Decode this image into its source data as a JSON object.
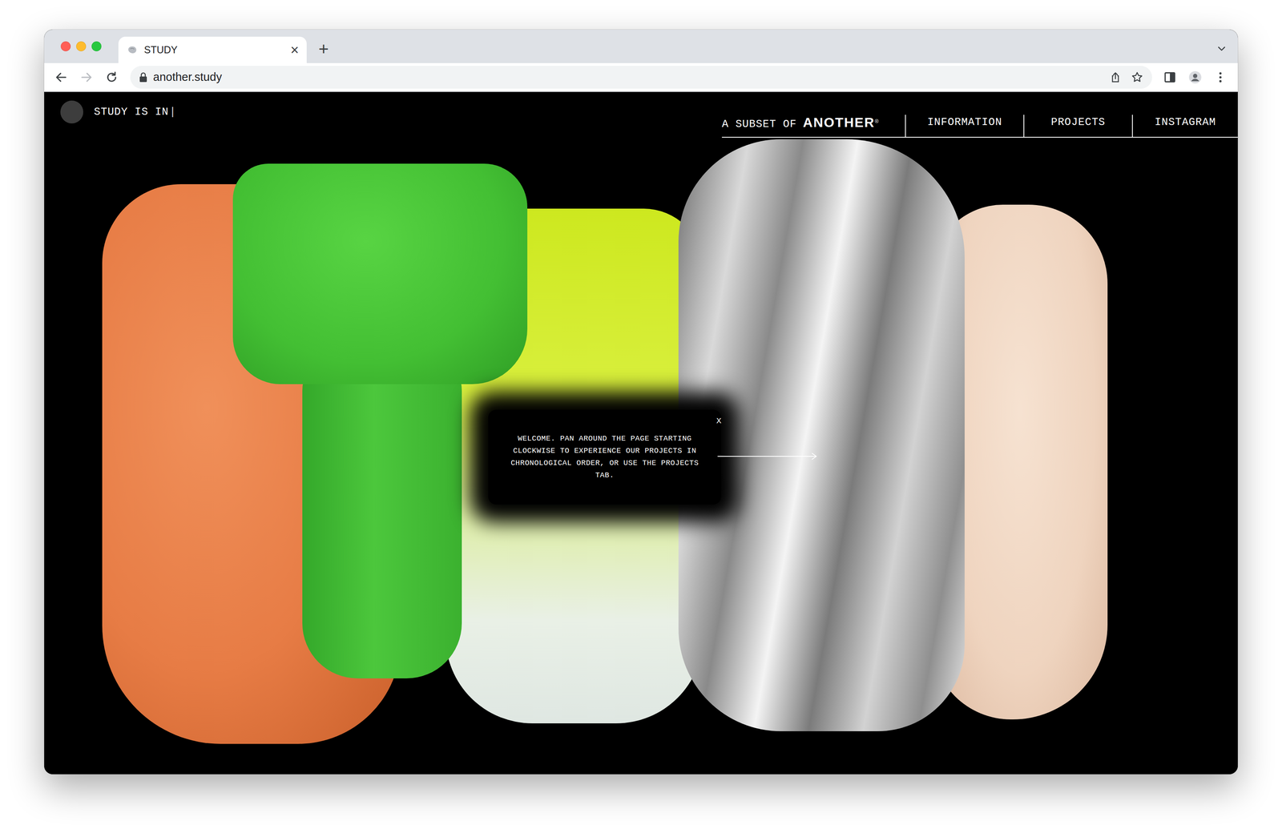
{
  "window": {
    "traffic_lights": [
      {
        "color": "#ff5f57"
      },
      {
        "color": "#febc2e"
      },
      {
        "color": "#28c840"
      }
    ]
  },
  "tabs": [
    {
      "label": "STUDY",
      "selected": true,
      "close": "×"
    }
  ],
  "new_tab": "+",
  "address": {
    "url": "another.study"
  },
  "site": {
    "status": {
      "text": "STUDY IS IN",
      "cursor": "|"
    },
    "nav": {
      "prefix": "A SUBSET OF",
      "brand": "ANOTHER",
      "brand_mark": "®",
      "links": [
        {
          "label": "INFORMATION"
        },
        {
          "label": "PROJECTS"
        },
        {
          "label": "INSTAGRAM"
        }
      ]
    }
  },
  "welcome": {
    "close": "X",
    "message": "WELCOME. PAN AROUND THE PAGE STARTING CLOCKWISE TO EXPERIENCE OUR PROJECTS IN CHRONOLOGICAL ORDER, OR USE THE PROJECTS TAB."
  }
}
